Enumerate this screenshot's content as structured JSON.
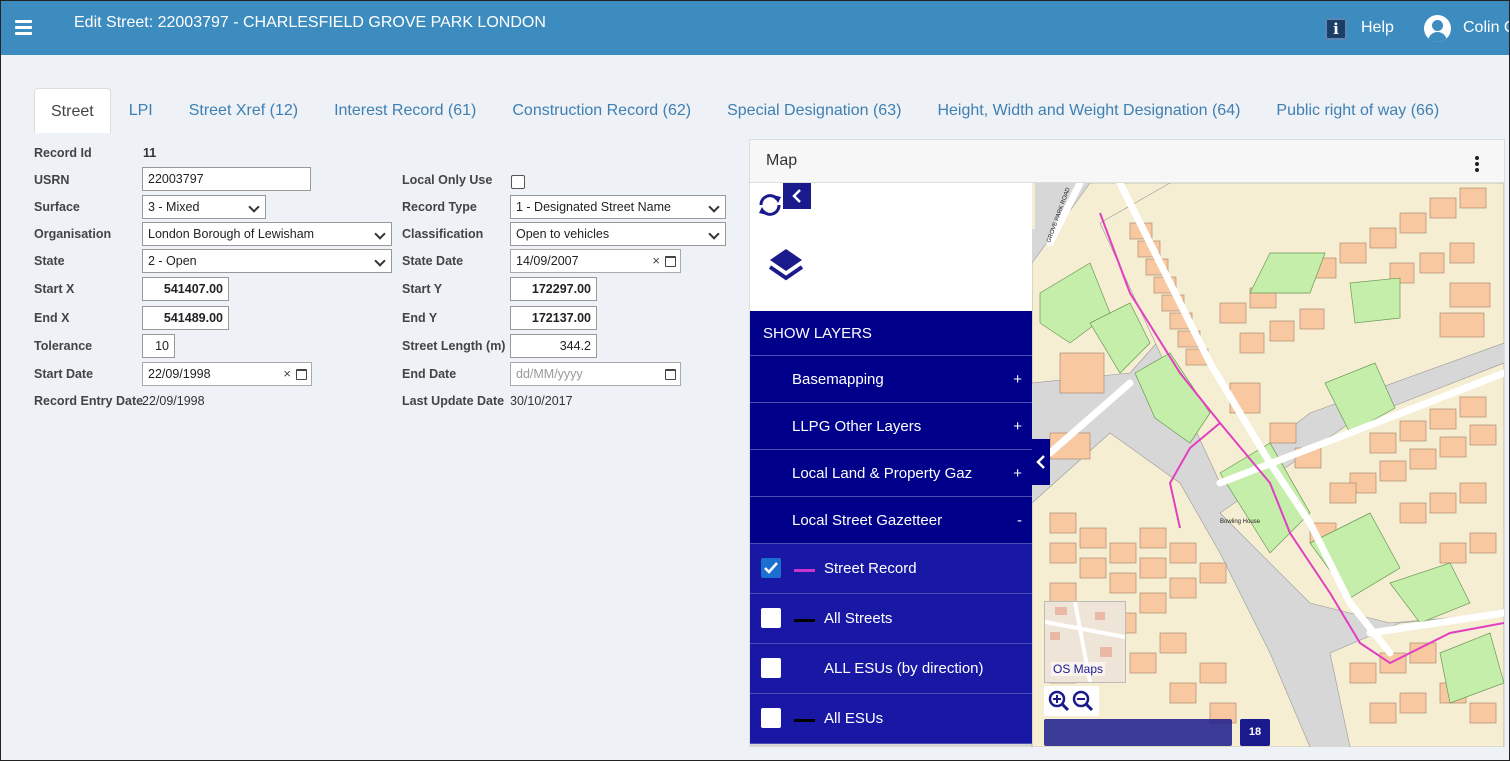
{
  "header": {
    "title": "Edit Street: 22003797 - CHARLESFIELD GROVE PARK LONDON",
    "help_label": "Help",
    "user_label": "Colin C"
  },
  "tabs": [
    {
      "label": "Street"
    },
    {
      "label": "LPI"
    },
    {
      "label": "Street Xref (12)"
    },
    {
      "label": "Interest Record (61)"
    },
    {
      "label": "Construction Record (62)"
    },
    {
      "label": "Special Designation (63)"
    },
    {
      "label": "Height, Width and Weight Designation (64)"
    },
    {
      "label": "Public right of way (66)"
    }
  ],
  "form": {
    "record_id": {
      "label": "Record Id",
      "value": "11"
    },
    "usrn": {
      "label": "USRN",
      "value": "22003797"
    },
    "surface": {
      "label": "Surface",
      "value": "3 - Mixed"
    },
    "organisation": {
      "label": "Organisation",
      "value": "London Borough of Lewisham"
    },
    "state": {
      "label": "State",
      "value": "2 - Open"
    },
    "start_x": {
      "label": "Start X",
      "value": "541407.00"
    },
    "end_x": {
      "label": "End X",
      "value": "541489.00"
    },
    "tolerance": {
      "label": "Tolerance",
      "value": "10"
    },
    "start_date": {
      "label": "Start Date",
      "value": "22/09/1998"
    },
    "record_entry_date": {
      "label": "Record Entry Date",
      "value": "22/09/1998"
    },
    "local_only_use": {
      "label": "Local Only Use",
      "checked": false
    },
    "record_type": {
      "label": "Record Type",
      "value": "1 - Designated Street Name"
    },
    "classification": {
      "label": "Classification",
      "value": "Open to vehicles"
    },
    "state_date": {
      "label": "State Date",
      "value": "14/09/2007"
    },
    "start_y": {
      "label": "Start Y",
      "value": "172297.00"
    },
    "end_y": {
      "label": "End Y",
      "value": "172137.00"
    },
    "street_length": {
      "label": "Street Length (m)",
      "value": "344.2"
    },
    "end_date": {
      "label": "End Date",
      "placeholder": "dd/MM/yyyy"
    },
    "last_update_date": {
      "label": "Last Update Date",
      "value": "30/10/2017"
    }
  },
  "map": {
    "title": "Map",
    "show_layers": "SHOW LAYERS",
    "groups": [
      {
        "label": "Basemapping",
        "toggle": "+"
      },
      {
        "label": "LLPG Other Layers",
        "toggle": "+"
      },
      {
        "label": "Local Land & Property Gaz",
        "toggle": "+"
      },
      {
        "label": "Local Street Gazetteer",
        "toggle": "-"
      }
    ],
    "sublayers": [
      {
        "label": "Street Record",
        "checked": true,
        "color": "#cc33cc"
      },
      {
        "label": "All Streets",
        "checked": false,
        "color": "#000000"
      },
      {
        "label": "ALL ESUs (by direction)",
        "checked": false,
        "color": ""
      },
      {
        "label": "All ESUs",
        "checked": false,
        "color": "#000000"
      }
    ],
    "minimap_label": "OS Maps",
    "zoom_level": "18",
    "road_label": "GROVE PARK ROAD",
    "building_label": "Bowling House"
  },
  "colors": {
    "header_bg": "#3d8cbf",
    "layer_panel_bg": "#00008b",
    "building_fill": "#f8c9a0",
    "green_fill": "#c5eeaa",
    "street_record_line": "#e040c0"
  }
}
